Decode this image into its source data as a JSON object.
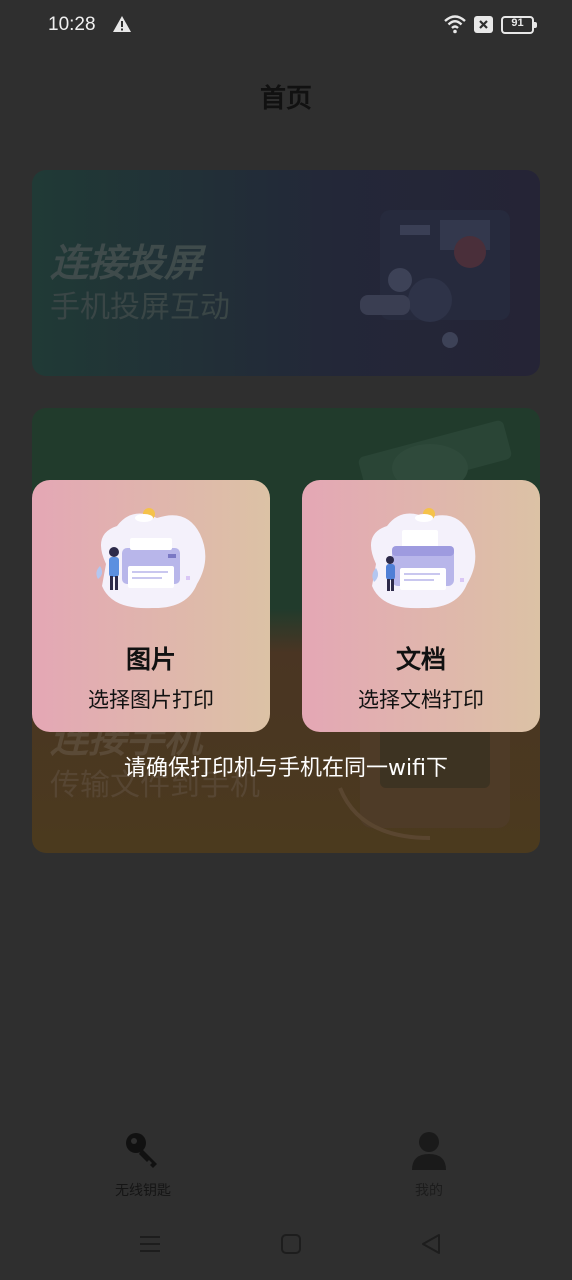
{
  "status_bar": {
    "time": "10:28",
    "battery": "91"
  },
  "header": {
    "title": "首页"
  },
  "feature_cards": [
    {
      "title": "连接投屏",
      "subtitle": "手机投屏互动"
    },
    {
      "title": "连接手机",
      "subtitle": "传输文件到手机"
    }
  ],
  "print_options": [
    {
      "title": "图片",
      "subtitle": "选择图片打印"
    },
    {
      "title": "文档",
      "subtitle": "选择文档打印"
    }
  ],
  "hint": "请确保打印机与手机在同一wifi下",
  "bottom_nav": [
    {
      "label": "无线钥匙",
      "icon": "key-icon"
    },
    {
      "label": "我的",
      "icon": "user-icon"
    }
  ],
  "colors": {
    "background": "#2f2f2f",
    "card_gradient_start": "#e4a7b5",
    "card_gradient_end": "#dcc2a5"
  }
}
